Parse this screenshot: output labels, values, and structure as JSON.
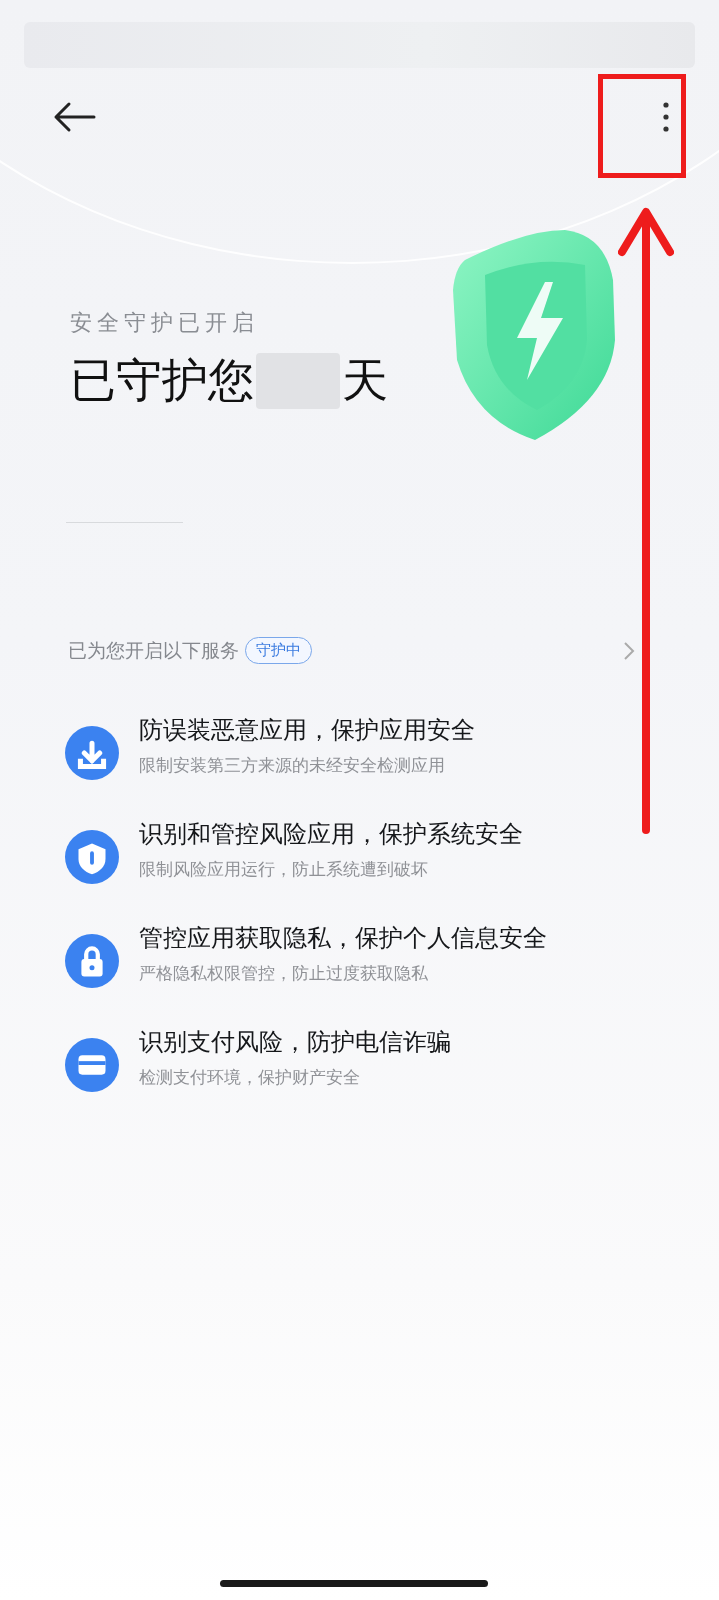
{
  "header": {
    "status": "安全守护已开启",
    "headline_prefix": "已守护您",
    "headline_suffix": "天"
  },
  "services": {
    "heading": "已为您开启以下服务",
    "badge": "守护中",
    "items": [
      {
        "kind": "download",
        "title": "防误装恶意应用，保护应用安全",
        "subtitle": "限制安装第三方来源的未经安全检测应用"
      },
      {
        "kind": "shield",
        "title": "识别和管控风险应用，保护系统安全",
        "subtitle": "限制风险应用运行，防止系统遭到破坏"
      },
      {
        "kind": "lock",
        "title": "管控应用获取隐私，保护个人信息安全",
        "subtitle": "严格隐私权限管控，防止过度获取隐私"
      },
      {
        "kind": "card",
        "title": "识别支付风险，防护电信诈骗",
        "subtitle": "检测支付环境，保护财产安全"
      }
    ]
  }
}
